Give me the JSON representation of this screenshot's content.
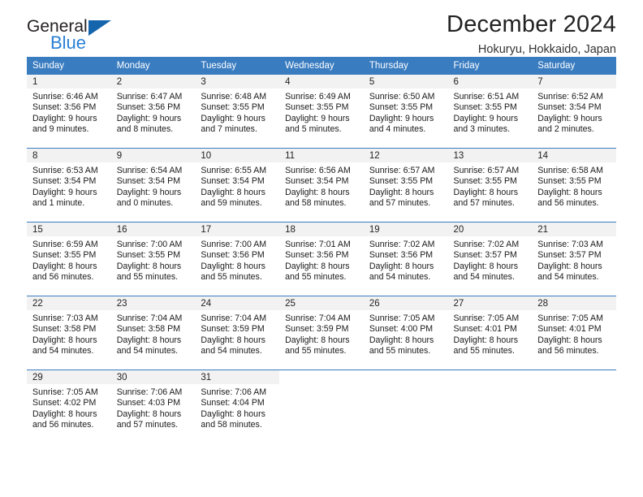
{
  "brand": {
    "name_part1": "General",
    "name_part2": "Blue",
    "accent_color": "#2980d4",
    "triangle_color": "#1565ad"
  },
  "header": {
    "title": "December 2024",
    "subtitle": "Hokuryu, Hokkaido, Japan"
  },
  "theme": {
    "header_row_bg": "#3a7cc0",
    "daynum_band_bg": "#f2f2f2",
    "separator_color": "#3a7cc0"
  },
  "weekdays": [
    "Sunday",
    "Monday",
    "Tuesday",
    "Wednesday",
    "Thursday",
    "Friday",
    "Saturday"
  ],
  "weeks": [
    [
      {
        "day": "1",
        "sunrise": "Sunrise: 6:46 AM",
        "sunset": "Sunset: 3:56 PM",
        "daylight1": "Daylight: 9 hours",
        "daylight2": "and 9 minutes."
      },
      {
        "day": "2",
        "sunrise": "Sunrise: 6:47 AM",
        "sunset": "Sunset: 3:56 PM",
        "daylight1": "Daylight: 9 hours",
        "daylight2": "and 8 minutes."
      },
      {
        "day": "3",
        "sunrise": "Sunrise: 6:48 AM",
        "sunset": "Sunset: 3:55 PM",
        "daylight1": "Daylight: 9 hours",
        "daylight2": "and 7 minutes."
      },
      {
        "day": "4",
        "sunrise": "Sunrise: 6:49 AM",
        "sunset": "Sunset: 3:55 PM",
        "daylight1": "Daylight: 9 hours",
        "daylight2": "and 5 minutes."
      },
      {
        "day": "5",
        "sunrise": "Sunrise: 6:50 AM",
        "sunset": "Sunset: 3:55 PM",
        "daylight1": "Daylight: 9 hours",
        "daylight2": "and 4 minutes."
      },
      {
        "day": "6",
        "sunrise": "Sunrise: 6:51 AM",
        "sunset": "Sunset: 3:55 PM",
        "daylight1": "Daylight: 9 hours",
        "daylight2": "and 3 minutes."
      },
      {
        "day": "7",
        "sunrise": "Sunrise: 6:52 AM",
        "sunset": "Sunset: 3:54 PM",
        "daylight1": "Daylight: 9 hours",
        "daylight2": "and 2 minutes."
      }
    ],
    [
      {
        "day": "8",
        "sunrise": "Sunrise: 6:53 AM",
        "sunset": "Sunset: 3:54 PM",
        "daylight1": "Daylight: 9 hours",
        "daylight2": "and 1 minute."
      },
      {
        "day": "9",
        "sunrise": "Sunrise: 6:54 AM",
        "sunset": "Sunset: 3:54 PM",
        "daylight1": "Daylight: 9 hours",
        "daylight2": "and 0 minutes."
      },
      {
        "day": "10",
        "sunrise": "Sunrise: 6:55 AM",
        "sunset": "Sunset: 3:54 PM",
        "daylight1": "Daylight: 8 hours",
        "daylight2": "and 59 minutes."
      },
      {
        "day": "11",
        "sunrise": "Sunrise: 6:56 AM",
        "sunset": "Sunset: 3:54 PM",
        "daylight1": "Daylight: 8 hours",
        "daylight2": "and 58 minutes."
      },
      {
        "day": "12",
        "sunrise": "Sunrise: 6:57 AM",
        "sunset": "Sunset: 3:55 PM",
        "daylight1": "Daylight: 8 hours",
        "daylight2": "and 57 minutes."
      },
      {
        "day": "13",
        "sunrise": "Sunrise: 6:57 AM",
        "sunset": "Sunset: 3:55 PM",
        "daylight1": "Daylight: 8 hours",
        "daylight2": "and 57 minutes."
      },
      {
        "day": "14",
        "sunrise": "Sunrise: 6:58 AM",
        "sunset": "Sunset: 3:55 PM",
        "daylight1": "Daylight: 8 hours",
        "daylight2": "and 56 minutes."
      }
    ],
    [
      {
        "day": "15",
        "sunrise": "Sunrise: 6:59 AM",
        "sunset": "Sunset: 3:55 PM",
        "daylight1": "Daylight: 8 hours",
        "daylight2": "and 56 minutes."
      },
      {
        "day": "16",
        "sunrise": "Sunrise: 7:00 AM",
        "sunset": "Sunset: 3:55 PM",
        "daylight1": "Daylight: 8 hours",
        "daylight2": "and 55 minutes."
      },
      {
        "day": "17",
        "sunrise": "Sunrise: 7:00 AM",
        "sunset": "Sunset: 3:56 PM",
        "daylight1": "Daylight: 8 hours",
        "daylight2": "and 55 minutes."
      },
      {
        "day": "18",
        "sunrise": "Sunrise: 7:01 AM",
        "sunset": "Sunset: 3:56 PM",
        "daylight1": "Daylight: 8 hours",
        "daylight2": "and 55 minutes."
      },
      {
        "day": "19",
        "sunrise": "Sunrise: 7:02 AM",
        "sunset": "Sunset: 3:56 PM",
        "daylight1": "Daylight: 8 hours",
        "daylight2": "and 54 minutes."
      },
      {
        "day": "20",
        "sunrise": "Sunrise: 7:02 AM",
        "sunset": "Sunset: 3:57 PM",
        "daylight1": "Daylight: 8 hours",
        "daylight2": "and 54 minutes."
      },
      {
        "day": "21",
        "sunrise": "Sunrise: 7:03 AM",
        "sunset": "Sunset: 3:57 PM",
        "daylight1": "Daylight: 8 hours",
        "daylight2": "and 54 minutes."
      }
    ],
    [
      {
        "day": "22",
        "sunrise": "Sunrise: 7:03 AM",
        "sunset": "Sunset: 3:58 PM",
        "daylight1": "Daylight: 8 hours",
        "daylight2": "and 54 minutes."
      },
      {
        "day": "23",
        "sunrise": "Sunrise: 7:04 AM",
        "sunset": "Sunset: 3:58 PM",
        "daylight1": "Daylight: 8 hours",
        "daylight2": "and 54 minutes."
      },
      {
        "day": "24",
        "sunrise": "Sunrise: 7:04 AM",
        "sunset": "Sunset: 3:59 PM",
        "daylight1": "Daylight: 8 hours",
        "daylight2": "and 54 minutes."
      },
      {
        "day": "25",
        "sunrise": "Sunrise: 7:04 AM",
        "sunset": "Sunset: 3:59 PM",
        "daylight1": "Daylight: 8 hours",
        "daylight2": "and 55 minutes."
      },
      {
        "day": "26",
        "sunrise": "Sunrise: 7:05 AM",
        "sunset": "Sunset: 4:00 PM",
        "daylight1": "Daylight: 8 hours",
        "daylight2": "and 55 minutes."
      },
      {
        "day": "27",
        "sunrise": "Sunrise: 7:05 AM",
        "sunset": "Sunset: 4:01 PM",
        "daylight1": "Daylight: 8 hours",
        "daylight2": "and 55 minutes."
      },
      {
        "day": "28",
        "sunrise": "Sunrise: 7:05 AM",
        "sunset": "Sunset: 4:01 PM",
        "daylight1": "Daylight: 8 hours",
        "daylight2": "and 56 minutes."
      }
    ],
    [
      {
        "day": "29",
        "sunrise": "Sunrise: 7:05 AM",
        "sunset": "Sunset: 4:02 PM",
        "daylight1": "Daylight: 8 hours",
        "daylight2": "and 56 minutes."
      },
      {
        "day": "30",
        "sunrise": "Sunrise: 7:06 AM",
        "sunset": "Sunset: 4:03 PM",
        "daylight1": "Daylight: 8 hours",
        "daylight2": "and 57 minutes."
      },
      {
        "day": "31",
        "sunrise": "Sunrise: 7:06 AM",
        "sunset": "Sunset: 4:04 PM",
        "daylight1": "Daylight: 8 hours",
        "daylight2": "and 58 minutes."
      },
      {
        "day": "",
        "sunrise": "",
        "sunset": "",
        "daylight1": "",
        "daylight2": ""
      },
      {
        "day": "",
        "sunrise": "",
        "sunset": "",
        "daylight1": "",
        "daylight2": ""
      },
      {
        "day": "",
        "sunrise": "",
        "sunset": "",
        "daylight1": "",
        "daylight2": ""
      },
      {
        "day": "",
        "sunrise": "",
        "sunset": "",
        "daylight1": "",
        "daylight2": ""
      }
    ]
  ]
}
